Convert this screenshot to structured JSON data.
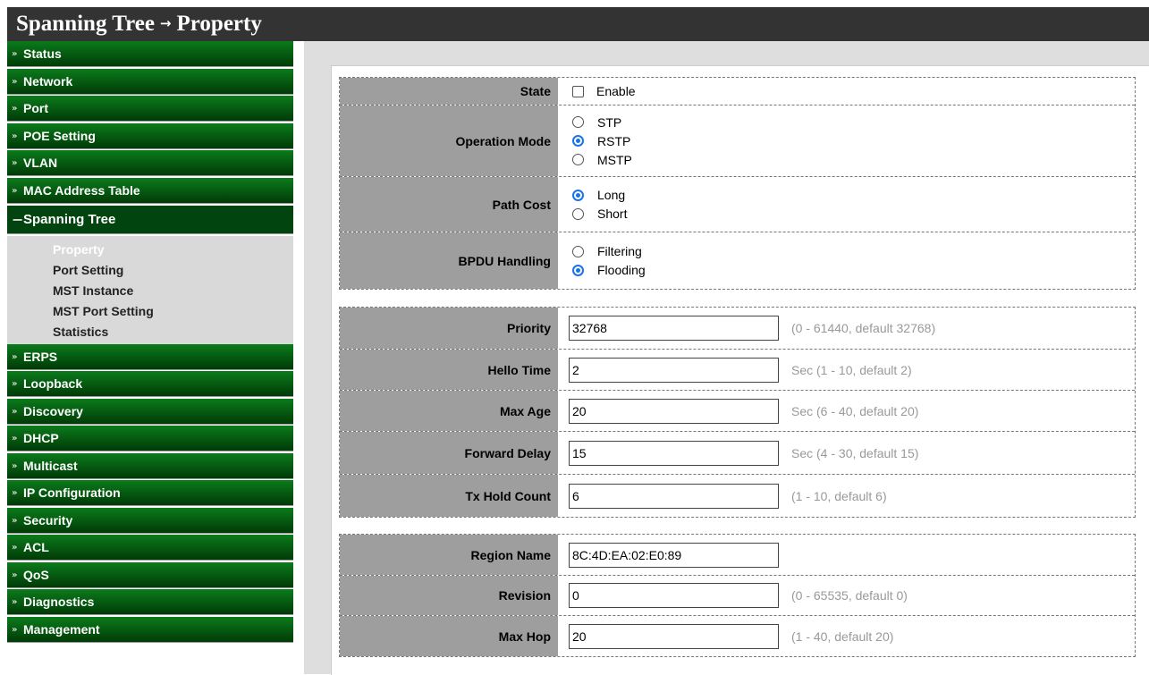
{
  "header": {
    "section": "Spanning Tree",
    "arrow": "→",
    "page": "Property"
  },
  "sidebar": {
    "before": [
      {
        "label": "Status"
      },
      {
        "label": "Network"
      },
      {
        "label": "Port"
      },
      {
        "label": "POE Setting"
      },
      {
        "label": "VLAN"
      },
      {
        "label": "MAC Address Table"
      }
    ],
    "open": {
      "label": "Spanning Tree",
      "icon": "−"
    },
    "sub": [
      {
        "label": "Property"
      },
      {
        "label": "Port Setting"
      },
      {
        "label": "MST Instance"
      },
      {
        "label": "MST Port Setting"
      },
      {
        "label": "Statistics"
      }
    ],
    "after": [
      {
        "label": "ERPS"
      },
      {
        "label": "Loopback"
      },
      {
        "label": "Discovery"
      },
      {
        "label": "DHCP"
      },
      {
        "label": "Multicast"
      },
      {
        "label": "IP Configuration"
      },
      {
        "label": "Security"
      },
      {
        "label": "ACL"
      },
      {
        "label": "QoS"
      },
      {
        "label": "Diagnostics"
      },
      {
        "label": "Management"
      }
    ],
    "chevron": "»"
  },
  "group1": {
    "state": {
      "label": "State",
      "checkbox_label": "Enable",
      "checked": false
    },
    "operation_mode": {
      "label": "Operation Mode",
      "options": [
        "STP",
        "RSTP",
        "MSTP"
      ],
      "selected": "RSTP"
    },
    "path_cost": {
      "label": "Path Cost",
      "options": [
        "Long",
        "Short"
      ],
      "selected": "Long"
    },
    "bpdu_handling": {
      "label": "BPDU Handling",
      "options": [
        "Filtering",
        "Flooding"
      ],
      "selected": "Flooding"
    }
  },
  "group2": {
    "priority": {
      "label": "Priority",
      "value": "32768",
      "hint": "(0 - 61440, default 32768)"
    },
    "hello_time": {
      "label": "Hello Time",
      "value": "2",
      "hint": "Sec (1 - 10, default 2)"
    },
    "max_age": {
      "label": "Max Age",
      "value": "20",
      "hint": "Sec (6 - 40, default 20)"
    },
    "forward_delay": {
      "label": "Forward Delay",
      "value": "15",
      "hint": "Sec (4 - 30, default 15)"
    },
    "tx_hold_count": {
      "label": "Tx Hold Count",
      "value": "6",
      "hint": "(1 - 10, default 6)"
    }
  },
  "group3": {
    "region_name": {
      "label": "Region Name",
      "value": "8C:4D:EA:02:E0:89"
    },
    "revision": {
      "label": "Revision",
      "value": "0",
      "hint": "(0 - 65535, default 0)"
    },
    "max_hop": {
      "label": "Max Hop",
      "value": "20",
      "hint": "(1 - 40, default 20)"
    }
  },
  "colors": {
    "nav_green_top": "#0b7b1b",
    "nav_green_bottom": "#003b07",
    "header_bg": "#333333",
    "label_bg": "#9e9e9e",
    "radio_blue": "#1a73e8"
  }
}
